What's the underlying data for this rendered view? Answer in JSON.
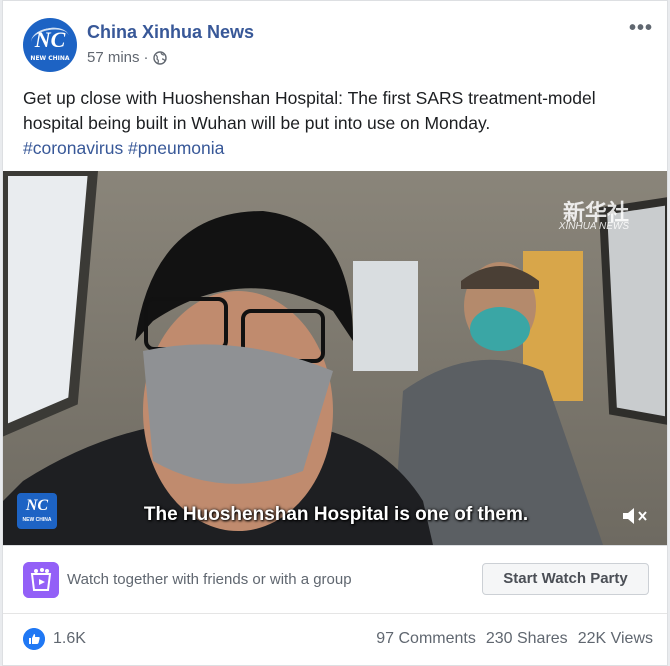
{
  "post": {
    "page_name": "China Xinhua News",
    "timestamp": "57 mins",
    "logo_text": "NC",
    "logo_subtext": "NEW CHINA",
    "text": "Get up close with Huoshenshan Hospital: The first SARS treatment-model hospital being built in Wuhan will be put into use on Monday.",
    "hashtags": "#coronavirus #pneumonia"
  },
  "video": {
    "subtitle": "The Huoshenshan Hospital is one of them.",
    "watermark_zh": "新华社",
    "watermark_en": "XINHUA NEWS",
    "logo_text": "NC",
    "logo_subtext": "NEW CHINA"
  },
  "watch_party": {
    "prompt": "Watch together with friends or with a group",
    "button_label": "Start Watch Party"
  },
  "stats": {
    "likes": "1.6K",
    "comments": "97 Comments",
    "shares": "230 Shares",
    "views": "22K Views"
  },
  "colors": {
    "brand_blue": "#385898",
    "like_blue": "#2078f4",
    "watch_purple": "#9360f7"
  }
}
